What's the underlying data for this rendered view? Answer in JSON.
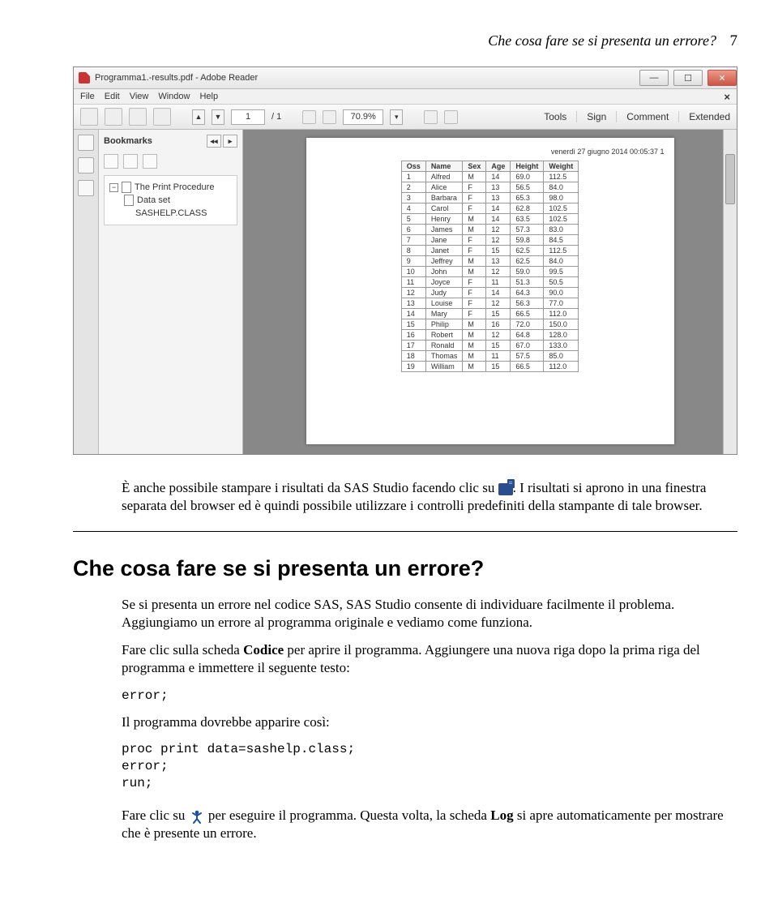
{
  "pageHeader": {
    "title": "Che cosa fare se si presenta un errore?",
    "num": "7"
  },
  "reader": {
    "windowTitle": "Programma1.-results.pdf - Adobe Reader",
    "menu": [
      "File",
      "Edit",
      "View",
      "Window",
      "Help"
    ],
    "pageField": "1",
    "pageTotal": "/ 1",
    "zoom": "70.9%",
    "rightTools": [
      "Tools",
      "Sign",
      "Comment",
      "Extended"
    ],
    "bookmarksLabel": "Bookmarks",
    "tree": {
      "item1": "The Print Procedure",
      "item2": "Data set",
      "item3": "SASHELP.CLASS"
    },
    "docHeader": "venerdì 27 giugno 2014 00:05:37    1",
    "cols": [
      "Oss",
      "Name",
      "Sex",
      "Age",
      "Height",
      "Weight"
    ],
    "rows": [
      [
        "1",
        "Alfred",
        "M",
        "14",
        "69.0",
        "112.5"
      ],
      [
        "2",
        "Alice",
        "F",
        "13",
        "56.5",
        "84.0"
      ],
      [
        "3",
        "Barbara",
        "F",
        "13",
        "65.3",
        "98.0"
      ],
      [
        "4",
        "Carol",
        "F",
        "14",
        "62.8",
        "102.5"
      ],
      [
        "5",
        "Henry",
        "M",
        "14",
        "63.5",
        "102.5"
      ],
      [
        "6",
        "James",
        "M",
        "12",
        "57.3",
        "83.0"
      ],
      [
        "7",
        "Jane",
        "F",
        "12",
        "59.8",
        "84.5"
      ],
      [
        "8",
        "Janet",
        "F",
        "15",
        "62.5",
        "112.5"
      ],
      [
        "9",
        "Jeffrey",
        "M",
        "13",
        "62.5",
        "84.0"
      ],
      [
        "10",
        "John",
        "M",
        "12",
        "59.0",
        "99.5"
      ],
      [
        "11",
        "Joyce",
        "F",
        "11",
        "51.3",
        "50.5"
      ],
      [
        "12",
        "Judy",
        "F",
        "14",
        "64.3",
        "90.0"
      ],
      [
        "13",
        "Louise",
        "F",
        "12",
        "56.3",
        "77.0"
      ],
      [
        "14",
        "Mary",
        "F",
        "15",
        "66.5",
        "112.0"
      ],
      [
        "15",
        "Philip",
        "M",
        "16",
        "72.0",
        "150.0"
      ],
      [
        "16",
        "Robert",
        "M",
        "12",
        "64.8",
        "128.0"
      ],
      [
        "17",
        "Ronald",
        "M",
        "15",
        "67.0",
        "133.0"
      ],
      [
        "18",
        "Thomas",
        "M",
        "11",
        "57.5",
        "85.0"
      ],
      [
        "19",
        "William",
        "M",
        "15",
        "66.5",
        "112.0"
      ]
    ]
  },
  "p1a": "È anche possibile stampare i risultati da SAS Studio facendo clic su ",
  "p1b": ". I risultati si aprono in una finestra separata del browser ed è quindi possibile utilizzare i controlli predefiniti della stampante di tale browser.",
  "h1": "Che cosa fare se si presenta un errore?",
  "p2": "Se si presenta un errore nel codice SAS, SAS Studio consente di individuare facilmente il problema. Aggiungiamo un errore al programma originale e vediamo come funziona.",
  "p3a": "Fare clic sulla scheda ",
  "p3bold": "Codice",
  "p3b": " per aprire il programma. Aggiungere una nuova riga dopo la prima riga del programma e immettere il seguente testo:",
  "code1": "error;",
  "p4": "Il programma dovrebbe apparire così:",
  "code2": "proc print data=sashelp.class;\nerror;\nrun;",
  "p5a": "Fare clic su ",
  "p5b": " per eseguire il programma. Questa volta, la scheda ",
  "p5bold": "Log",
  "p5c": " si apre automaticamente per mostrare che è presente un errore."
}
